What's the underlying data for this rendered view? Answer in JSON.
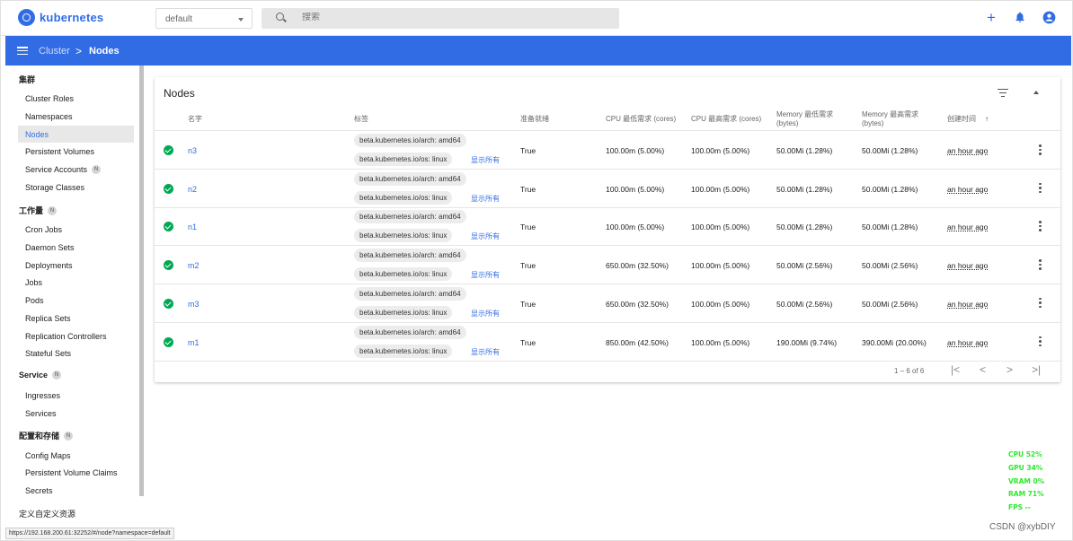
{
  "app": {
    "name": "kubernetes"
  },
  "header": {
    "namespace": "default",
    "search_placeholder": "搜索",
    "icons": [
      "add-icon",
      "bell-icon",
      "account-icon"
    ]
  },
  "breadcrumb": {
    "parent": "Cluster",
    "separator": ">",
    "current": "Nodes"
  },
  "sidebar": {
    "groups": [
      {
        "label": "集群",
        "badge": "",
        "items": [
          "Cluster Roles",
          "Namespaces",
          "Nodes",
          "Persistent Volumes",
          "Service Accounts",
          "Storage Classes"
        ]
      },
      {
        "label": "工作量",
        "badge": "N",
        "items": [
          "Cron Jobs",
          "Daemon Sets",
          "Deployments",
          "Jobs",
          "Pods",
          "Replica Sets",
          "Replication Controllers",
          "Stateful Sets"
        ]
      },
      {
        "label": "Service",
        "badge": "N",
        "items": [
          "Ingresses",
          "Services"
        ]
      },
      {
        "label": "配置和存储",
        "badge": "N",
        "items": [
          "Config Maps",
          "Persistent Volume Claims",
          "Secrets"
        ]
      },
      {
        "label": "定义自定义资源",
        "badge": "",
        "items": []
      }
    ],
    "active_item": "Nodes",
    "service_accounts_badge": "N"
  },
  "card": {
    "title": "Nodes",
    "columns": [
      "名字",
      "标签",
      "准备就绪",
      "CPU 最低需求 (cores)",
      "CPU 最高需求 (cores)",
      "Memory 最低需求 (bytes)",
      "Memory 最高需求 (bytes)",
      "创建时间"
    ],
    "sort_indicator": "↑",
    "rows": [
      {
        "name": "n3",
        "label1": "beta.kubernetes.io/arch: amd64",
        "label2": "beta.kubernetes.io/os: linux",
        "show_all": "显示所有",
        "ready": "True",
        "cpu_req": "100.00m (5.00%)",
        "cpu_lim": "100.00m (5.00%)",
        "mem_req": "50.00Mi (1.28%)",
        "mem_lim": "50.00Mi (1.28%)",
        "created": "an hour ago"
      },
      {
        "name": "n2",
        "label1": "beta.kubernetes.io/arch: amd64",
        "label2": "beta.kubernetes.io/os: linux",
        "show_all": "显示所有",
        "ready": "True",
        "cpu_req": "100.00m (5.00%)",
        "cpu_lim": "100.00m (5.00%)",
        "mem_req": "50.00Mi (1.28%)",
        "mem_lim": "50.00Mi (1.28%)",
        "created": "an hour ago"
      },
      {
        "name": "n1",
        "label1": "beta.kubernetes.io/arch: amd64",
        "label2": "beta.kubernetes.io/os: linux",
        "show_all": "显示所有",
        "ready": "True",
        "cpu_req": "100.00m (5.00%)",
        "cpu_lim": "100.00m (5.00%)",
        "mem_req": "50.00Mi (1.28%)",
        "mem_lim": "50.00Mi (1.28%)",
        "created": "an hour ago"
      },
      {
        "name": "m2",
        "label1": "beta.kubernetes.io/arch: amd64",
        "label2": "beta.kubernetes.io/os: linux",
        "show_all": "显示所有",
        "ready": "True",
        "cpu_req": "650.00m (32.50%)",
        "cpu_lim": "100.00m (5.00%)",
        "mem_req": "50.00Mi (2.56%)",
        "mem_lim": "50.00Mi (2.56%)",
        "created": "an hour ago"
      },
      {
        "name": "m3",
        "label1": "beta.kubernetes.io/arch: amd64",
        "label2": "beta.kubernetes.io/os: linux",
        "show_all": "显示所有",
        "ready": "True",
        "cpu_req": "650.00m (32.50%)",
        "cpu_lim": "100.00m (5.00%)",
        "mem_req": "50.00Mi (2.56%)",
        "mem_lim": "50.00Mi (2.56%)",
        "created": "an hour ago"
      },
      {
        "name": "m1",
        "label1": "beta.kubernetes.io/arch: amd64",
        "label2": "beta.kubernetes.io/os: linux",
        "show_all": "显示所有",
        "ready": "True",
        "cpu_req": "850.00m (42.50%)",
        "cpu_lim": "100.00m (5.00%)",
        "mem_req": "190.00Mi (9.74%)",
        "mem_lim": "390.00Mi (20.00%)",
        "created": "an hour ago"
      }
    ],
    "pagination": {
      "range": "1 – 6 of 6",
      "first": "|<",
      "prev": "<",
      "next": ">",
      "last": ">|"
    }
  },
  "overlay": {
    "cpu": "CPU 52%",
    "gpu": "GPU 34%",
    "vram": "VRAM 0%",
    "ram": "RAM 71%",
    "fps": "FPS --"
  },
  "watermark": "CSDN @xybDIY",
  "status_url": "https://192.168.200.61:32252/#/node?namespace=default",
  "colors": {
    "brand": "#326ce5",
    "ready": "#00a854",
    "overlay": "#2ee82e"
  }
}
